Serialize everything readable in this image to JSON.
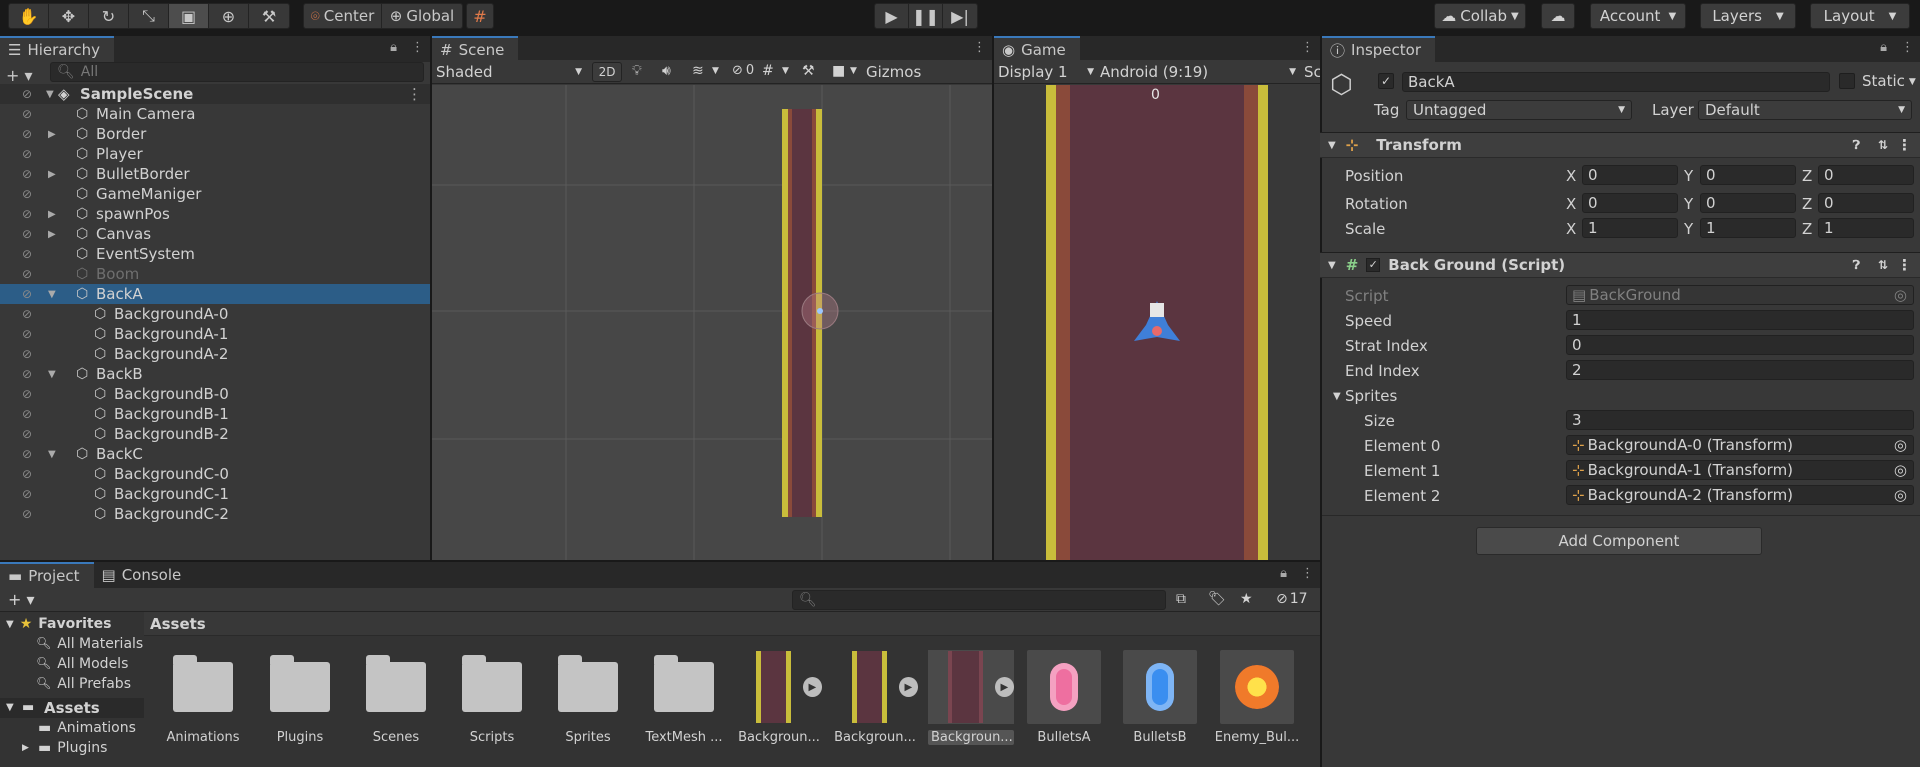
{
  "toolbar": {
    "pivot_label": "Center",
    "space_label": "Global",
    "collab_label": "Collab",
    "account_label": "Account",
    "layers_label": "Layers",
    "layout_label": "Layout"
  },
  "hierarchy": {
    "tab_label": "Hierarchy",
    "search_placeholder": "All",
    "scene_name": "SampleScene",
    "items": [
      {
        "label": "Main Camera"
      },
      {
        "label": "Border"
      },
      {
        "label": "Player"
      },
      {
        "label": "BulletBorder"
      },
      {
        "label": "GameManiger"
      },
      {
        "label": "spawnPos"
      },
      {
        "label": "Canvas"
      },
      {
        "label": "EventSystem"
      },
      {
        "label": "Boom"
      },
      {
        "label": "BackA"
      },
      {
        "label": "BackgroundA-0"
      },
      {
        "label": "BackgroundA-1"
      },
      {
        "label": "BackgroundA-2"
      },
      {
        "label": "BackB"
      },
      {
        "label": "BackgroundB-0"
      },
      {
        "label": "BackgroundB-1"
      },
      {
        "label": "BackgroundB-2"
      },
      {
        "label": "BackC"
      },
      {
        "label": "BackgroundC-0"
      },
      {
        "label": "BackgroundC-1"
      },
      {
        "label": "BackgroundC-2"
      }
    ]
  },
  "scene": {
    "tab_label": "Scene",
    "shading_mode": "Shaded",
    "mode_2d": "2D",
    "hidden_count": "0",
    "gizmos_label": "Gizmos"
  },
  "game": {
    "tab_label": "Game",
    "display": "Display 1",
    "aspect": "Android (9:19)",
    "scale_short": "Sc",
    "score": "0"
  },
  "inspector": {
    "tab_label": "Inspector",
    "object_name": "BackA",
    "static_label": "Static",
    "tag_label": "Tag",
    "tag_value": "Untagged",
    "layer_label": "Layer",
    "layer_value": "Default",
    "transform_title": "Transform",
    "position_label": "Position",
    "rotation_label": "Rotation",
    "scale_label": "Scale",
    "axis_x": "X",
    "axis_y": "Y",
    "axis_z": "Z",
    "position": {
      "x": "0",
      "y": "0",
      "z": "0"
    },
    "rotation": {
      "x": "0",
      "y": "0",
      "z": "0"
    },
    "scale": {
      "x": "1",
      "y": "1",
      "z": "1"
    },
    "script_title": "Back Ground (Script)",
    "script_label": "Script",
    "script_value": "BackGround",
    "speed_label": "Speed",
    "speed_value": "1",
    "strat_label": "Strat Index",
    "strat_value": "0",
    "end_label": "End Index",
    "end_value": "2",
    "sprites_label": "Sprites",
    "size_label": "Size",
    "size_value": "3",
    "elements": [
      {
        "label": "Element 0",
        "value": "BackgroundA-0 (Transform)"
      },
      {
        "label": "Element 1",
        "value": "BackgroundA-1 (Transform)"
      },
      {
        "label": "Element 2",
        "value": "BackgroundA-2 (Transform)"
      }
    ],
    "add_component": "Add Component"
  },
  "project": {
    "tab_project": "Project",
    "tab_console": "Console",
    "hidden_count": "17",
    "favorites_label": "Favorites",
    "favorites": [
      "All Materials",
      "All Models",
      "All Prefabs"
    ],
    "assets_root": "Assets",
    "asset_tree": [
      "Animations",
      "Plugins"
    ],
    "breadcrumb": "Assets",
    "assets": [
      {
        "label": "Animations",
        "kind": "folder"
      },
      {
        "label": "Plugins",
        "kind": "folder"
      },
      {
        "label": "Scenes",
        "kind": "folder"
      },
      {
        "label": "Scripts",
        "kind": "folder"
      },
      {
        "label": "Sprites",
        "kind": "folder"
      },
      {
        "label": "TextMesh ...",
        "kind": "folder"
      },
      {
        "label": "Backgroun...",
        "kind": "sprite-yellow"
      },
      {
        "label": "Backgroun...",
        "kind": "sprite-yellow2"
      },
      {
        "label": "Backgroun...",
        "kind": "sprite-dark"
      },
      {
        "label": "BulletsA",
        "kind": "bullet-pink"
      },
      {
        "label": "BulletsB",
        "kind": "bullet-blue"
      },
      {
        "label": "Enemy_Bul...",
        "kind": "bullet-orange"
      }
    ]
  },
  "colors": {
    "selection": "#2c5d87",
    "accent_tab": "#3a79bb",
    "road": "#5b3540",
    "road_edge": "#c9bd3b"
  }
}
